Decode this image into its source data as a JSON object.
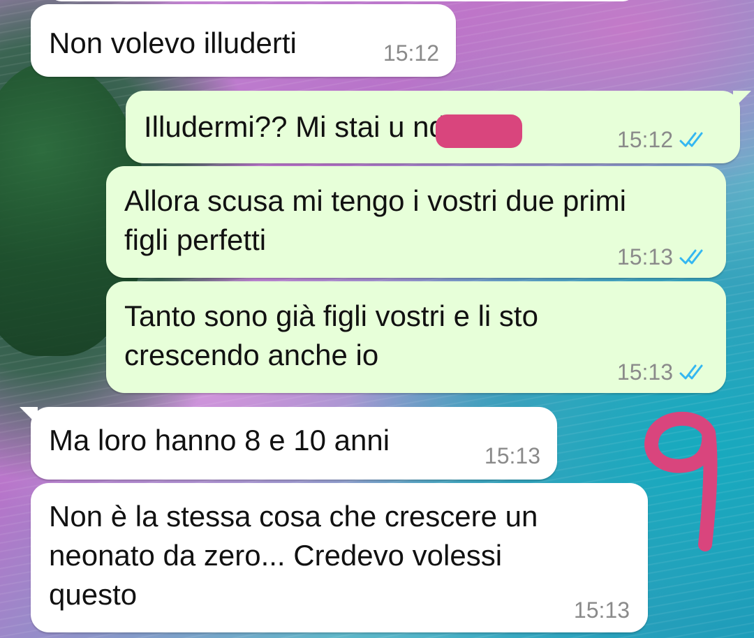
{
  "messages": [
    {
      "direction": "incoming",
      "text": "Non volevo illuderti",
      "time": "15:12"
    },
    {
      "direction": "outgoing",
      "text": "Illudermi?? Mi stai u           ndo!",
      "time": "15:12",
      "status": "read"
    },
    {
      "direction": "outgoing",
      "text": "Allora scusa mi tengo i vostri due primi\nfigli perfetti",
      "time": "15:13",
      "status": "read"
    },
    {
      "direction": "outgoing",
      "text": "Tanto sono già figli vostri e li sto\ncrescendo anche io",
      "time": "15:13",
      "status": "read"
    },
    {
      "direction": "incoming",
      "text": "Ma loro hanno 8 e 10 anni",
      "time": "15:13"
    },
    {
      "direction": "incoming",
      "text": "Non è la stessa cosa che crescere un\nneonato da zero... Credevo volessi\nquesto",
      "time": "15:13"
    }
  ],
  "annotation": {
    "number": "9",
    "color": "#d9457d"
  },
  "colors": {
    "incoming_bubble": "#ffffff",
    "outgoing_bubble": "#e7ffd9",
    "read_ticks": "#34b7f1",
    "timestamp": "#8a8a8a",
    "redaction": "#d9457d"
  },
  "icons": {
    "read_status": "double-check-icon"
  }
}
